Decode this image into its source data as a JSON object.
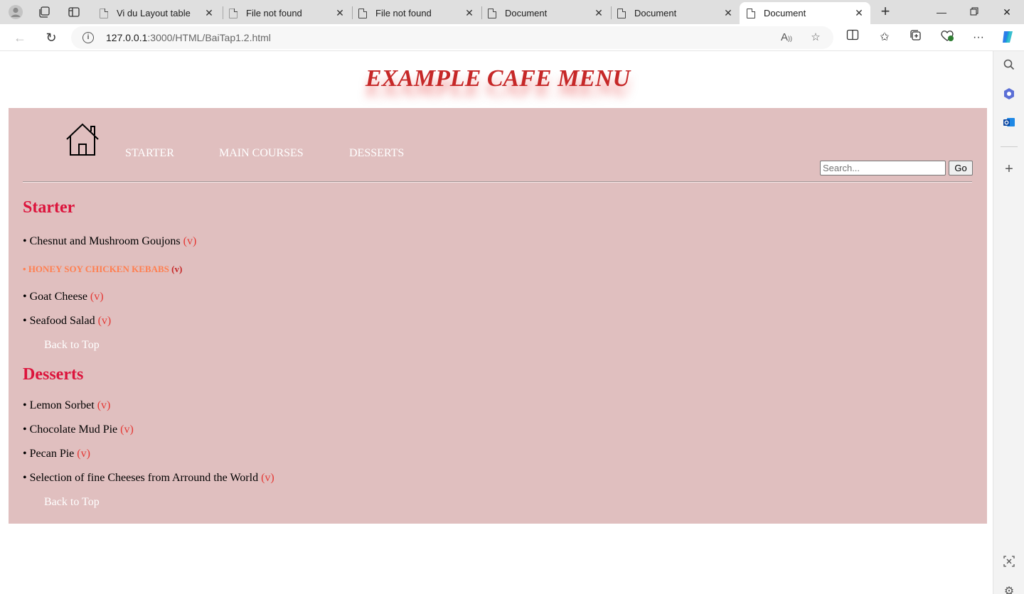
{
  "browser": {
    "tabs": [
      {
        "title": "Vi du Layout table",
        "active": false
      },
      {
        "title": "File not found",
        "active": false
      },
      {
        "title": "File not found",
        "active": false
      },
      {
        "title": "Document",
        "active": false
      },
      {
        "title": "Document",
        "active": false
      },
      {
        "title": "Document",
        "active": true
      }
    ],
    "url_host": "127.0.0.1",
    "url_rest": ":3000/HTML/BaiTap1.2.html",
    "close_glyph": "✕"
  },
  "page": {
    "title": "EXAMPLE CAFE MENU",
    "nav": {
      "home_icon": "home-icon",
      "links": [
        "STARTER",
        "MAIN COURSES",
        "DESSERTS"
      ],
      "search_placeholder": "Search...",
      "go_label": "Go"
    },
    "sections": [
      {
        "title": "Starter",
        "items": [
          {
            "bullet": "• ",
            "name": "Chesnut and Mushroom Goujons",
            "veg": "(v)",
            "special": false
          },
          {
            "bullet": "• ",
            "name": "HONEY SOY CHICKEN KEBABS",
            "veg": "(v)",
            "special": true
          },
          {
            "bullet": "• ",
            "name": "Goat Cheese",
            "veg": "(v)",
            "special": false
          },
          {
            "bullet": "• ",
            "name": "Seafood Salad",
            "veg": "(v)",
            "special": false
          }
        ],
        "back_to_top": "Back to Top"
      },
      {
        "title": "Desserts",
        "items": [
          {
            "bullet": "• ",
            "name": "Lemon Sorbet",
            "veg": "(v)",
            "special": false
          },
          {
            "bullet": "• ",
            "name": "Chocolate Mud Pie",
            "veg": "(v)",
            "special": false
          },
          {
            "bullet": "• ",
            "name": "Pecan Pie",
            "veg": "(v)",
            "special": false
          },
          {
            "bullet": "• ",
            "name": "Selection of fine Cheeses from Arround the World",
            "veg": "(v)",
            "special": false
          }
        ],
        "back_to_top": "Back to Top"
      }
    ]
  },
  "colors": {
    "title": "#c62828",
    "panel_bg": "#e0bfbf",
    "section_title": "#dc143c",
    "veg_mark": "#e53935",
    "special_item": "#ff7f50",
    "nav_link": "#ffffff"
  }
}
